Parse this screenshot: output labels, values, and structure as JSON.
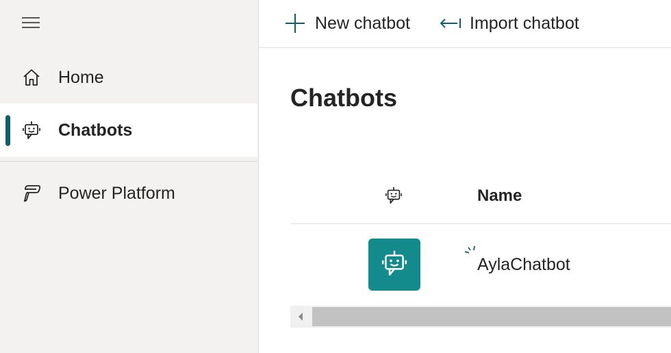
{
  "sidebar": {
    "menu_icon": "hamburger-icon",
    "items": [
      {
        "id": "home",
        "label": "Home",
        "icon": "home-icon",
        "selected": false
      },
      {
        "id": "chatbots",
        "label": "Chatbots",
        "icon": "bot-icon",
        "selected": true
      },
      {
        "id": "power-platform",
        "label": "Power Platform",
        "icon": "power-platform-icon",
        "selected": false
      }
    ]
  },
  "toolbar": {
    "new_label": "New chatbot",
    "new_icon": "plus-icon",
    "import_label": "Import chatbot",
    "import_icon": "import-arrow-icon"
  },
  "main": {
    "title": "Chatbots",
    "table": {
      "columns": [
        {
          "id": "icon",
          "label": "",
          "icon": "bot-icon"
        },
        {
          "id": "name",
          "label": "Name"
        }
      ],
      "rows": [
        {
          "name": "AylaChatbot",
          "icon": "bot-icon",
          "status_icon": "loading-spinner-icon"
        }
      ]
    }
  },
  "colors": {
    "sidebar_bg": "#f3f2f1",
    "accent": "#0f5f6b",
    "bot_tile": "#138a8c",
    "text": "#242424"
  }
}
